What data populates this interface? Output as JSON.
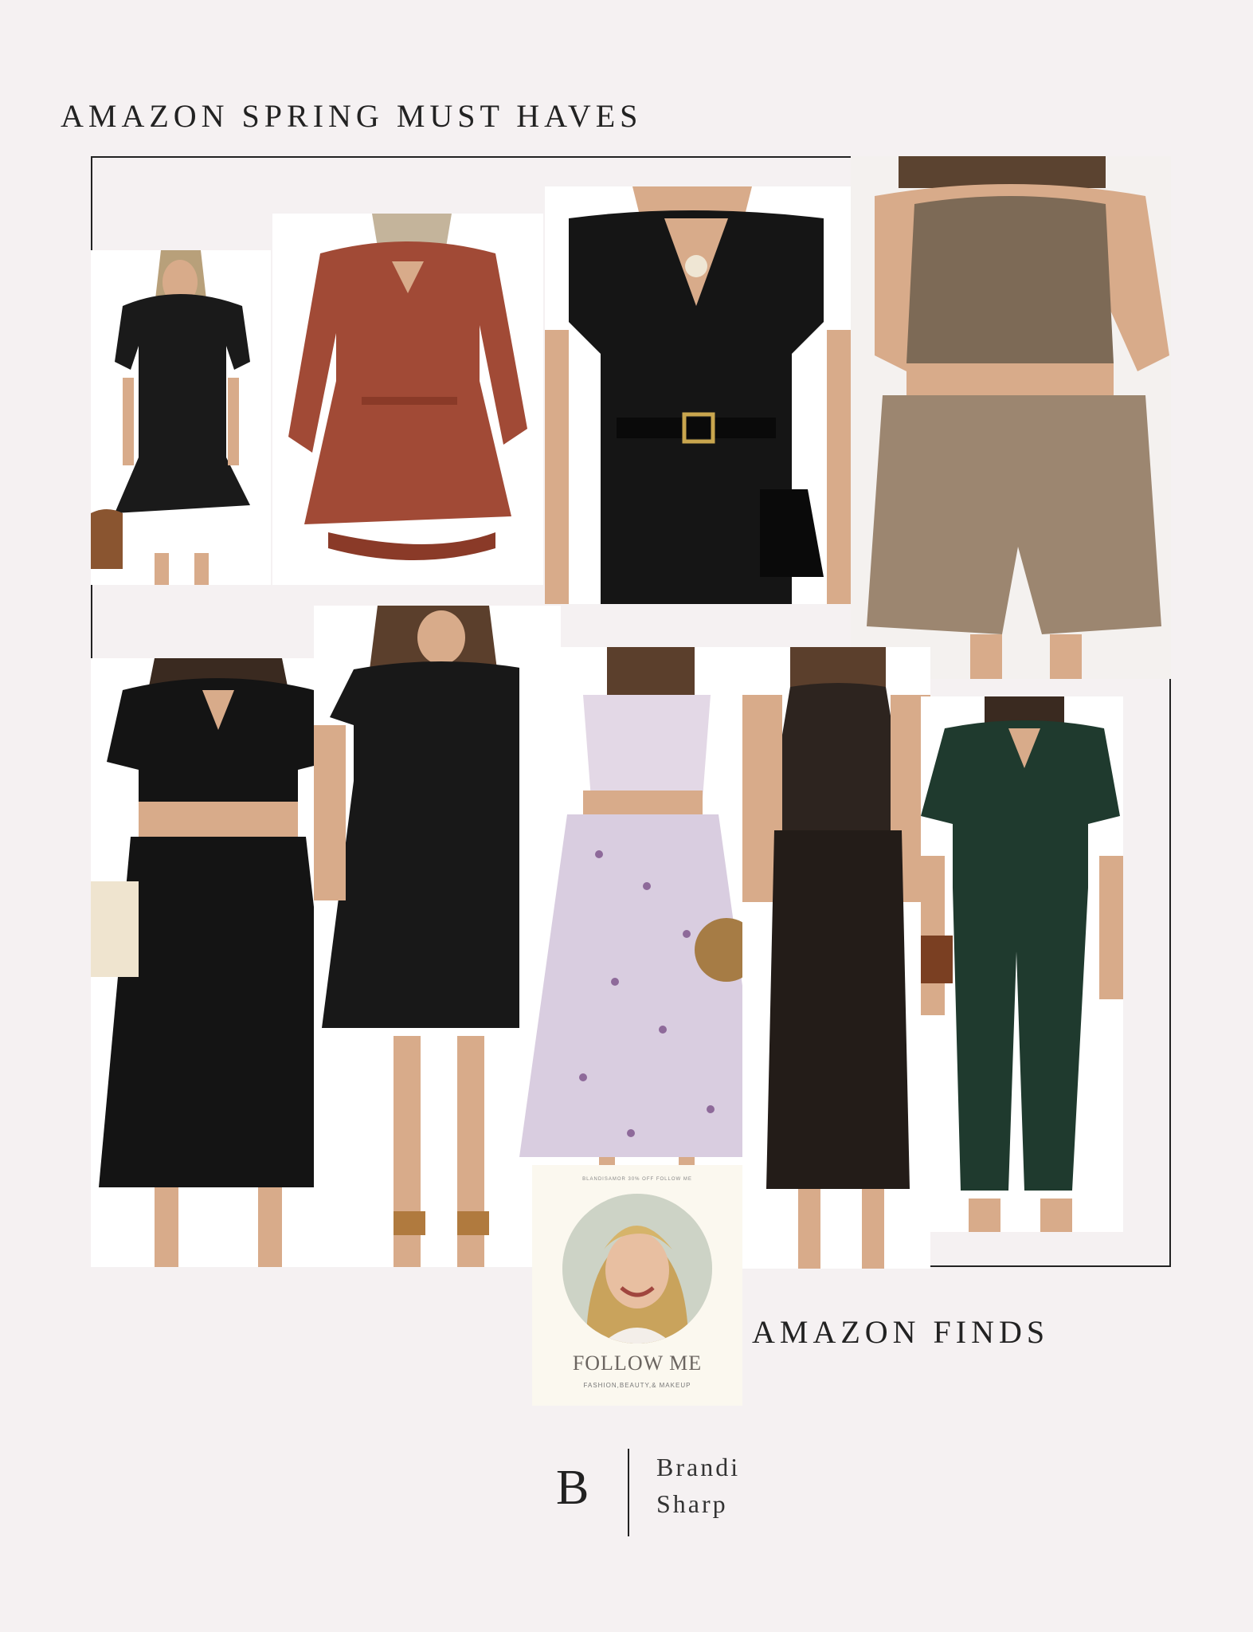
{
  "header": {
    "title": "AMAZON SPRING MUST HAVES"
  },
  "collage": {
    "items": [
      {
        "icon": "black-ruffle-mini-dress-photo",
        "color": "#1a1a1a"
      },
      {
        "icon": "rust-long-sleeve-mini-dress-photo",
        "color": "#a14a36"
      },
      {
        "icon": "black-belted-jumpsuit-photo",
        "color": "#151515"
      },
      {
        "icon": "taupe-crop-top-shorts-set-photo",
        "color": "#7d6a56"
      },
      {
        "icon": "black-wrap-top-maxi-skirt-set-photo",
        "color": "#141414"
      },
      {
        "icon": "black-smocked-midi-dress-photo",
        "color": "#181818"
      },
      {
        "icon": "floral-one-shoulder-skirt-set-photo",
        "color": "#d9cde0"
      },
      {
        "icon": "brown-halter-maxi-dress-photo",
        "color": "#2d241f"
      },
      {
        "icon": "green-wrap-jumpsuit-photo",
        "color": "#1f3a2e"
      }
    ]
  },
  "promo": {
    "label": "AMAZON FINDS",
    "card_small": "BLANDISAMOR 30% OFF FOLLOW ME",
    "card_title": "FOLLOW ME",
    "card_subtitle": "FASHION,BEAUTY,& MAKEUP"
  },
  "brand": {
    "initial": "B",
    "first_name": "Brandi",
    "last_name": "Sharp"
  }
}
